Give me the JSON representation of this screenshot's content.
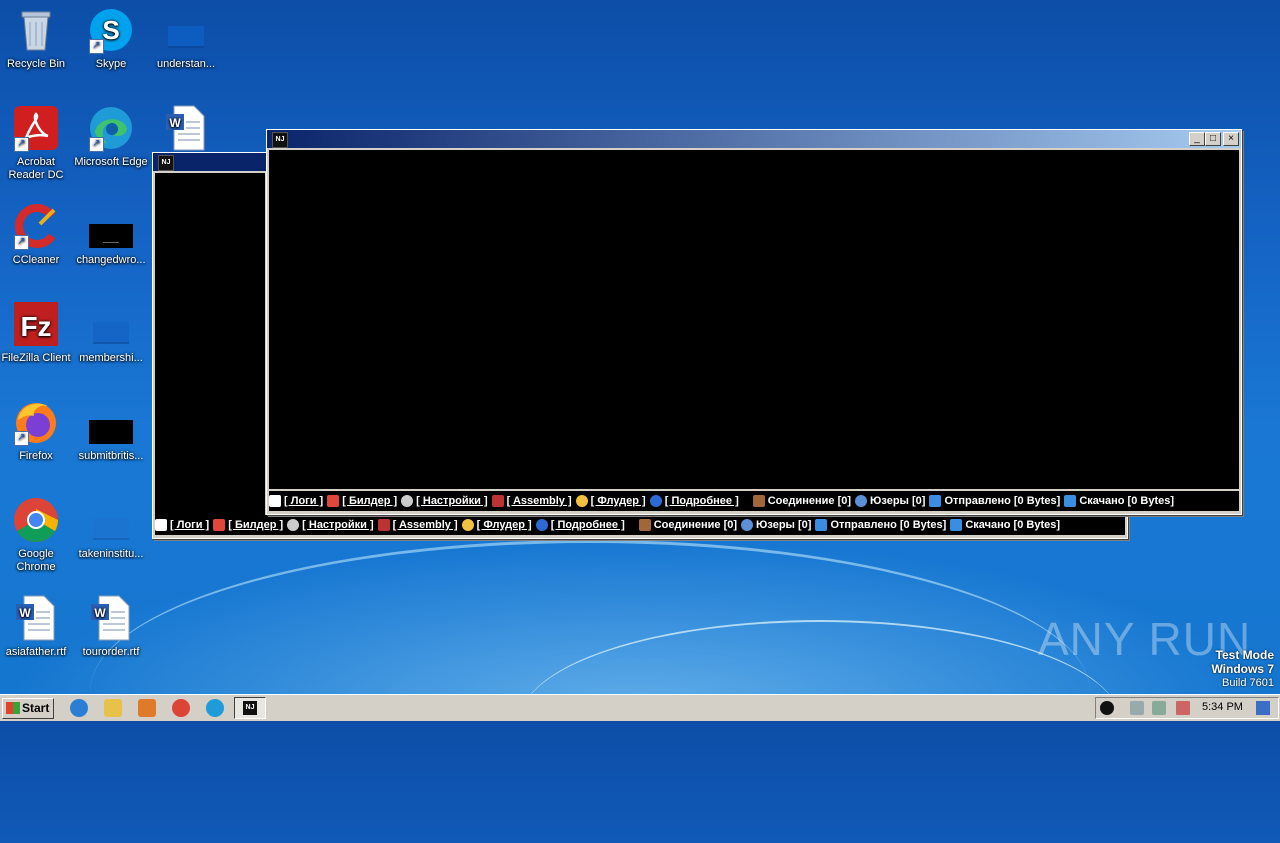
{
  "desktop": {
    "icons": [
      {
        "label": "Recycle Bin"
      },
      {
        "label": "Skype"
      },
      {
        "label": "understan..."
      },
      {
        "label": "Acrobat Reader DC"
      },
      {
        "label": "Microsoft Edge"
      },
      {
        "label": "CCleaner"
      },
      {
        "label": "changedwro..."
      },
      {
        "label": "FileZilla Client"
      },
      {
        "label": "membershi..."
      },
      {
        "label": "Firefox"
      },
      {
        "label": "submitbritis..."
      },
      {
        "label": "Google Chrome"
      },
      {
        "label": "takeninstitu..."
      },
      {
        "label": "asiafather.rtf"
      },
      {
        "label": "tourorder.rtf"
      }
    ],
    "watermark": {
      "brand": "ANY RUN",
      "line1": "Test Mode",
      "line2": "Windows 7",
      "line3": "Build 7601"
    }
  },
  "window": {
    "app_icon_text": "NJ",
    "min_label": "_",
    "max_label": "□",
    "close_label": "×",
    "status": {
      "logs": "[ Логи ]",
      "builder": "[ Билдер ]",
      "settings": "[ Настройки ]",
      "assembly": "[ Assembly ]",
      "flooder": "[ Флудер ]",
      "more": "[ Подробнее ]",
      "connection": "Соединение [0]",
      "users": "Юзеры [0]",
      "sent": "Отправлено [0 Bytes]",
      "received": "Скачано [0 Bytes]"
    }
  },
  "taskbar": {
    "start_label": "Start",
    "clock": "5:34 PM",
    "active_app_icon": "NJ"
  },
  "colors": {
    "titlebar_active": "#0a246a",
    "titlebar_gradient_end": "#a6caf0",
    "console_bg": "#000000"
  }
}
